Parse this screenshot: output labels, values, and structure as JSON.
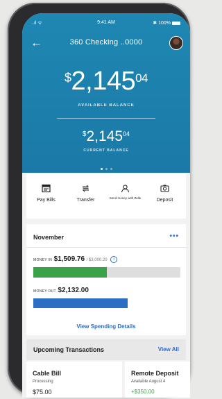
{
  "status_bar": {
    "carrier": "..ıl ᯤ",
    "time": "9:41 AM",
    "battery": "✱ 100%"
  },
  "header": {
    "title": "360 Checking ..0000"
  },
  "balances": {
    "available": {
      "currency": "$",
      "whole": "2,145",
      "cents": "04",
      "label": "AVAILABLE BALANCE"
    },
    "current": {
      "currency": "$",
      "whole": "2,145",
      "cents": "04",
      "label": "CURRENT BALANCE"
    }
  },
  "quick_actions": [
    {
      "label": "Pay Bills",
      "icon": "bill-icon"
    },
    {
      "label": "Transfer",
      "icon": "transfer-icon"
    },
    {
      "label": "Send money with Zelle",
      "icon": "zelle-icon"
    },
    {
      "label": "Deposit",
      "icon": "camera-icon"
    }
  ],
  "spending": {
    "month": "November",
    "more": "•••",
    "money_in_label": "MONEY IN",
    "money_in_amount": "$1,509.76",
    "money_in_total": "/ $3,000.20",
    "money_in_fraction": 0.5,
    "money_out_label": "MONEY OUT",
    "money_out_amount": "$2,132.00",
    "view_details": "View Spending Details"
  },
  "upcoming": {
    "title": "Upcoming Transactions",
    "view_all": "View All",
    "items": [
      {
        "name": "Cable Bill",
        "status": "Processing",
        "amount": "$75.00"
      },
      {
        "name": "Remote Deposit",
        "status": "Available August 4",
        "amount": "+$350.00"
      }
    ]
  },
  "colors": {
    "brand": "#1f87b3",
    "accent": "#2d6cc4",
    "positive": "#3aa34a"
  }
}
